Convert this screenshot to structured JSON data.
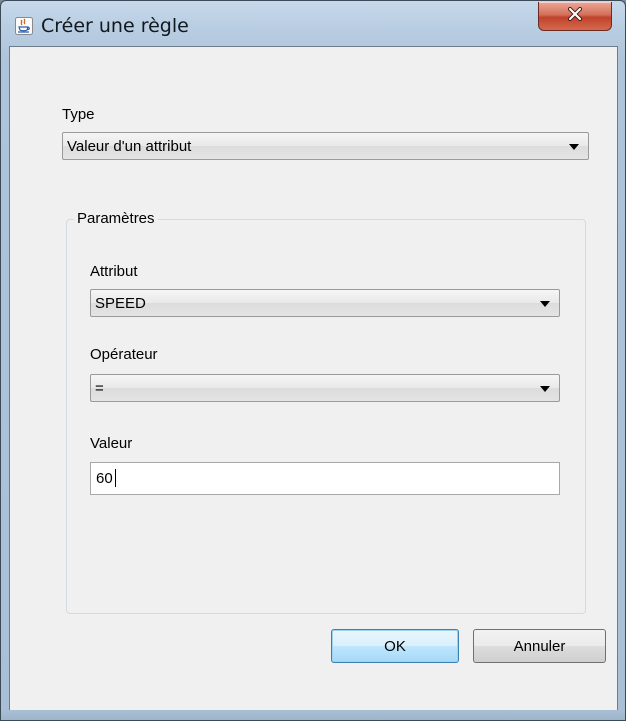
{
  "window": {
    "title": "Créer une règle",
    "icon": "java-cup-icon",
    "close_icon": "close-x-icon"
  },
  "form": {
    "type_label": "Type",
    "type_value": "Valeur d'un attribut",
    "parameters_legend": "Paramètres",
    "attribute_label": "Attribut",
    "attribute_value": "SPEED",
    "operator_label": "Opérateur",
    "operator_value": "=",
    "value_label": "Valeur",
    "value_input": "60"
  },
  "buttons": {
    "ok_label": "OK",
    "cancel_label": "Annuler"
  },
  "colors": {
    "close_button": "#c7503a",
    "default_button_border": "#3c7fb1",
    "client_background": "#f0f0f0"
  }
}
